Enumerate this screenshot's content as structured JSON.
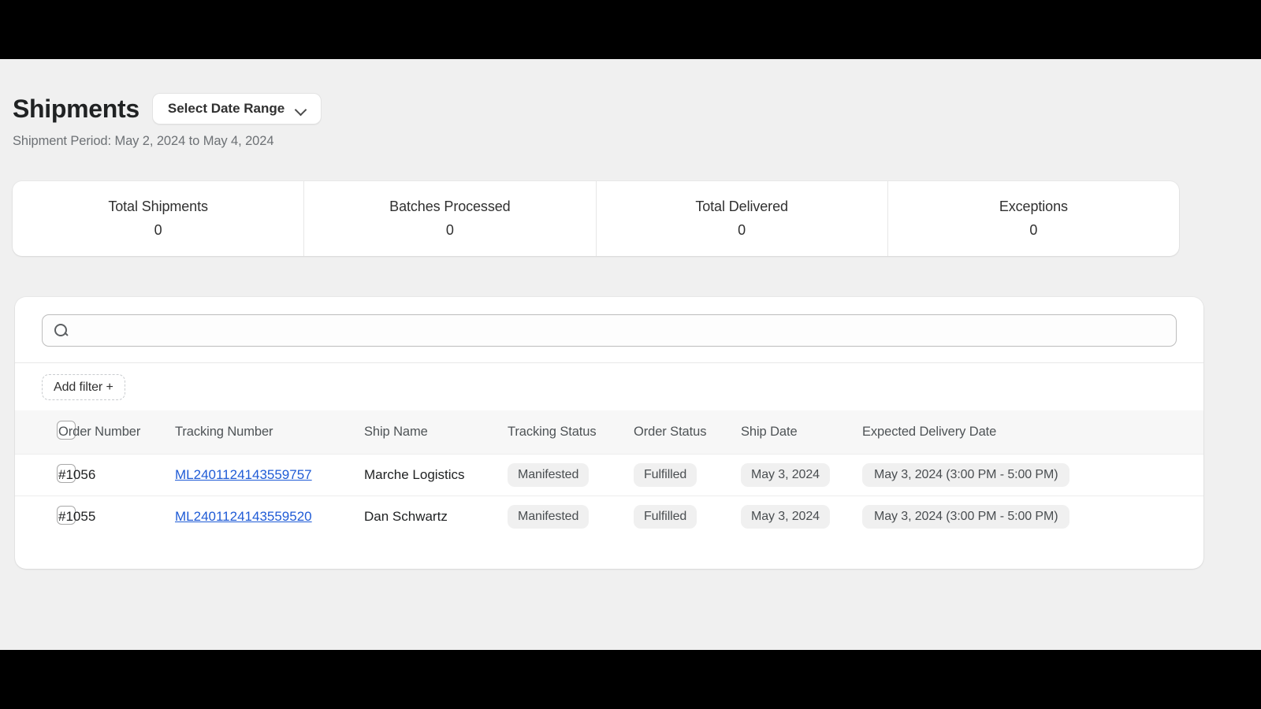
{
  "header": {
    "title": "Shipments",
    "date_range_button": "Select Date Range",
    "chevron_icon": "chevron-down-icon",
    "subtitle": "Shipment Period: May 2, 2024 to May 4, 2024"
  },
  "stats": [
    {
      "label": "Total Shipments",
      "value": "0"
    },
    {
      "label": "Batches Processed",
      "value": "0"
    },
    {
      "label": "Total Delivered",
      "value": "0"
    },
    {
      "label": "Exceptions",
      "value": "0"
    }
  ],
  "toolbar": {
    "search_icon": "search-icon",
    "search_value": "",
    "search_placeholder": "",
    "add_filter_label": "Add filter +"
  },
  "table": {
    "columns": [
      "Order Number",
      "Tracking Number",
      "Ship Name",
      "Tracking Status",
      "Order Status",
      "Ship Date",
      "Expected Delivery Date"
    ],
    "rows": [
      {
        "order_number": "#1056",
        "tracking_number": "ML2401124143559757",
        "ship_name": "Marche Logistics",
        "tracking_status": "Manifested",
        "order_status": "Fulfilled",
        "ship_date": "May 3, 2024",
        "expected_delivery_date": "May 3, 2024 (3:00 PM - 5:00 PM)"
      },
      {
        "order_number": "#1055",
        "tracking_number": "ML2401124143559520",
        "ship_name": "Dan Schwartz",
        "tracking_status": "Manifested",
        "order_status": "Fulfilled",
        "ship_date": "May 3, 2024",
        "expected_delivery_date": "May 3, 2024 (3:00 PM - 5:00 PM)"
      }
    ]
  },
  "colors": {
    "page_background": "#f0f0f0",
    "card_background": "#ffffff",
    "link": "#1f5bd6",
    "pill_background": "#f0f0f0",
    "text_primary": "#202223",
    "text_secondary": "#6d7175",
    "letterbox": "#000000"
  }
}
